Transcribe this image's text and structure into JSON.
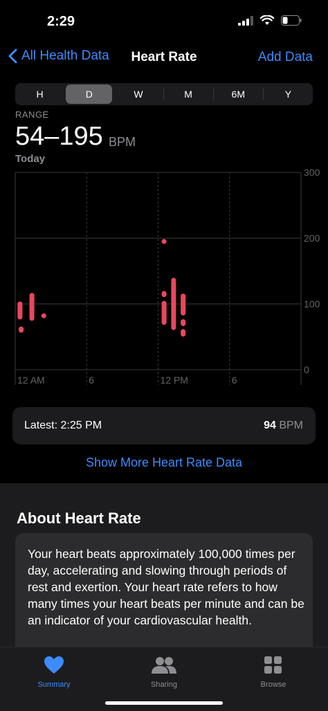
{
  "status_bar": {
    "time": "2:29"
  },
  "nav": {
    "back_label": "All Health Data",
    "title": "Heart Rate",
    "add_label": "Add Data"
  },
  "segments": {
    "items": [
      "H",
      "D",
      "W",
      "M",
      "6M",
      "Y"
    ],
    "selected": "D"
  },
  "summary": {
    "range_label": "RANGE",
    "range_value": "54–195",
    "unit": "BPM",
    "period": "Today"
  },
  "chart_data": {
    "type": "scatter",
    "x_tick_labels": [
      "12 AM",
      "6",
      "12 PM",
      "6"
    ],
    "y_tick_labels": [
      "300",
      "200",
      "100",
      "0"
    ],
    "ylim": [
      0,
      300
    ],
    "xlim_hours": [
      0,
      24
    ],
    "grid": true,
    "color": "#e8485e",
    "ranges": [
      {
        "hour": 0.4,
        "min": 80,
        "max": 100
      },
      {
        "hour": 0.5,
        "min": 60,
        "max": 62
      },
      {
        "hour": 1.4,
        "min": 78,
        "max": 113
      },
      {
        "hour": 2.4,
        "min": 82,
        "max": 82
      },
      {
        "hour": 12.5,
        "min": 72,
        "max": 101
      },
      {
        "hour": 12.5,
        "min": 114,
        "max": 116
      },
      {
        "hour": 12.5,
        "min": 195,
        "max": 195
      },
      {
        "hour": 13.3,
        "min": 64,
        "max": 132
      },
      {
        "hour": 13.3,
        "min": 136,
        "max": 136
      },
      {
        "hour": 14.1,
        "min": 54,
        "max": 58
      },
      {
        "hour": 14.1,
        "min": 70,
        "max": 73
      },
      {
        "hour": 14.1,
        "min": 86,
        "max": 112
      }
    ]
  },
  "latest": {
    "label": "Latest: 2:25 PM",
    "value": "94",
    "unit": "BPM"
  },
  "more_link": "Show More Heart Rate Data",
  "about": {
    "title": "About Heart Rate",
    "text": "Your heart beats approximately 100,000 times per day, accelerating and slowing through periods of rest and exertion. Your heart rate refers to how many times your heart beats per minute and can be an indicator of your cardiovascular health."
  },
  "tabs": [
    {
      "label": "Summary",
      "icon": "heart-icon",
      "active": true
    },
    {
      "label": "Sharing",
      "icon": "people-icon",
      "active": false
    },
    {
      "label": "Browse",
      "icon": "grid-icon",
      "active": false
    }
  ],
  "colors": {
    "accent": "#3d8bfd",
    "heart_rate": "#e8485e",
    "background": "#000000",
    "card": "#1c1c1e"
  }
}
